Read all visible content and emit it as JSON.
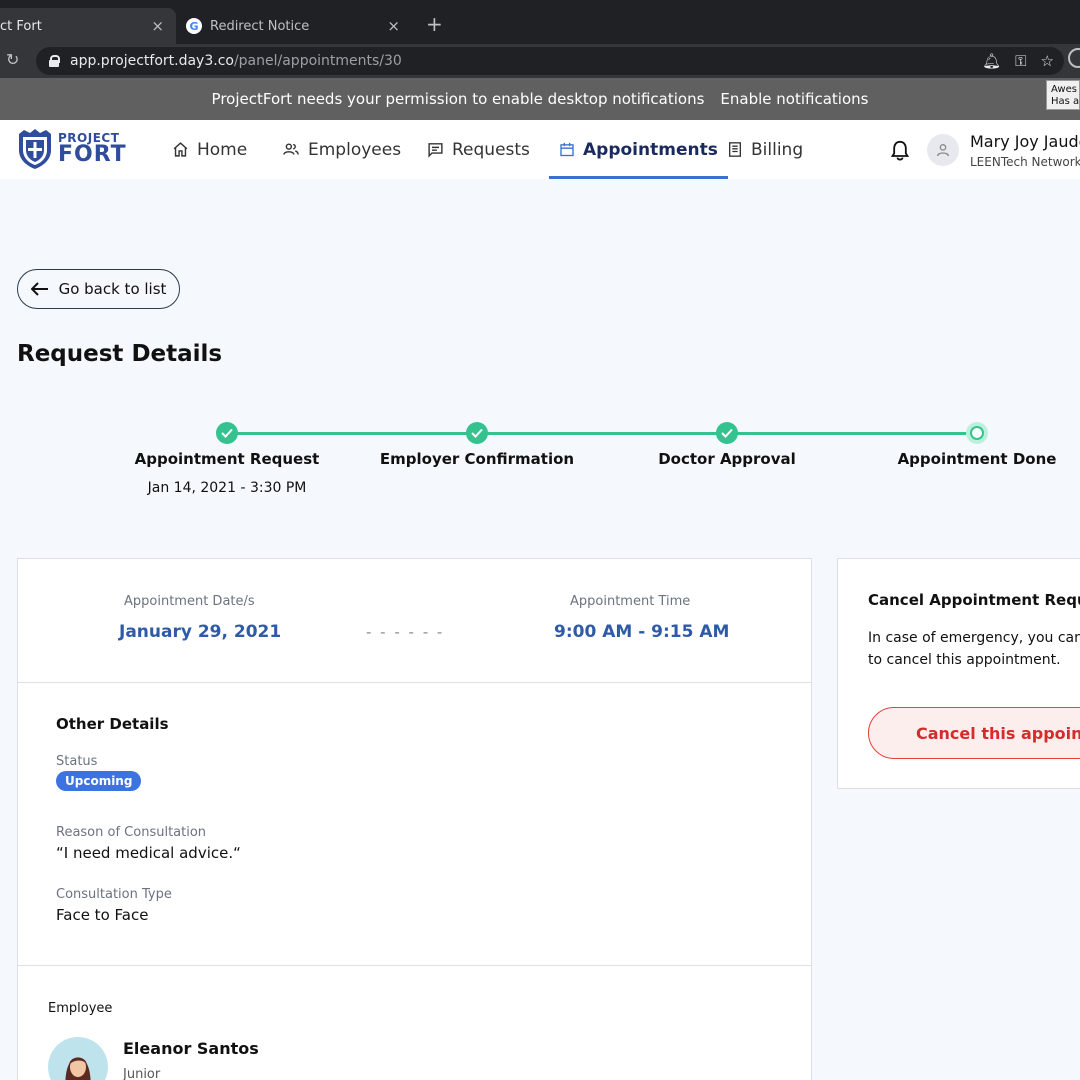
{
  "browser": {
    "tabs": [
      {
        "title": "ct Fort",
        "active": true
      },
      {
        "title": "Redirect Notice",
        "active": false
      }
    ],
    "new_tab_symbol": "+",
    "close_symbol": "×",
    "url_host": "app.projectfort.day3.co",
    "url_path": "/panel/appointments/30",
    "tooltip_line1": "Awes",
    "tooltip_line2": "Has a"
  },
  "notification_bar": {
    "message": "ProjectFort needs your permission to enable desktop notifications",
    "link": "Enable notifications"
  },
  "app": {
    "logo": {
      "line1": "PROJECT",
      "line2": "FORT"
    },
    "nav": [
      {
        "label": "Home",
        "icon": "home-icon"
      },
      {
        "label": "Employees",
        "icon": "people-icon"
      },
      {
        "label": "Requests",
        "icon": "chat-icon"
      },
      {
        "label": "Appointments",
        "icon": "calendar-icon",
        "active": true
      },
      {
        "label": "Billing",
        "icon": "receipt-icon"
      }
    ],
    "user": {
      "name": "Mary Joy Jaudo",
      "org": "LEENTech Network"
    }
  },
  "page": {
    "back_label": "Go back to list",
    "title": "Request Details",
    "steps": [
      {
        "label": "Appointment Request",
        "sub": "Jan 14, 2021 - 3:30 PM",
        "done": true
      },
      {
        "label": "Employer Confirmation",
        "done": true
      },
      {
        "label": "Doctor Approval",
        "done": true
      },
      {
        "label": "Appointment Done",
        "done": false,
        "current": true
      }
    ],
    "appointment": {
      "date_label": "Appointment Date/s",
      "date_value": "January 29, 2021",
      "separator": "- - - - - -",
      "time_label": "Appointment Time",
      "time_value": "9:00 AM - 9:15 AM"
    },
    "other_details": {
      "title": "Other Details",
      "status_label": "Status",
      "status_value": "Upcoming",
      "reason_label": "Reason of Consultation",
      "reason_value": "“I need medical advice.“",
      "type_label": "Consultation Type",
      "type_value": "Face to Face"
    },
    "employee": {
      "label": "Employee",
      "name": "Eleanor Santos",
      "role": "Junior"
    },
    "cancel_card": {
      "title": "Cancel Appointment Request",
      "text": "In case of emergency, you can to cancel this appointment.",
      "button": "Cancel this appointment"
    }
  },
  "colors": {
    "accent": "#3b6fd4",
    "step_green": "#34c38f",
    "value_blue": "#2f5aa8",
    "danger": "#d62b2b"
  }
}
